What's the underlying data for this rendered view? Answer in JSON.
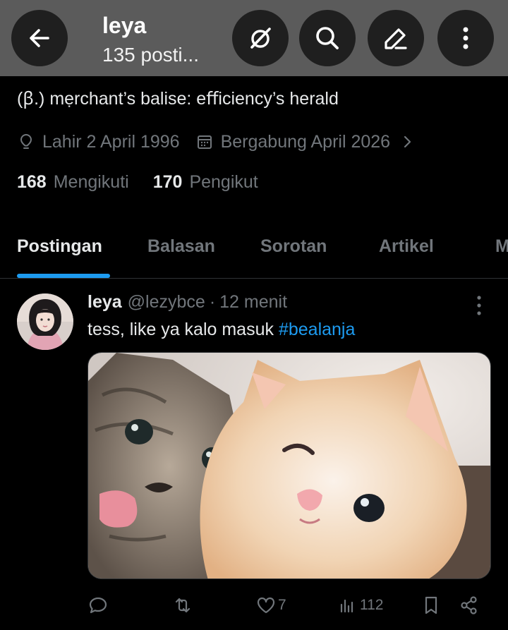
{
  "header": {
    "title": "leya",
    "subtitle": "135 posti..."
  },
  "profile": {
    "bio": "(ꞵ.) mẹrchant’s balise: eﬀiciency’s herald",
    "birth": "Lahir 2 April 1996",
    "joined": "Bergabung April 2026",
    "following_count": "168",
    "following_label": "Mengikuti",
    "followers_count": "170",
    "followers_label": "Pengikut"
  },
  "tabs": [
    "Postingan",
    "Balasan",
    "Sorotan",
    "Artikel",
    "M"
  ],
  "post": {
    "name": "leya",
    "handle": "@lezybce",
    "dot": "·",
    "time": "12 menit",
    "text": "tess, like ya kalo masuk",
    "hashtag": "#bealanja",
    "likes": "7",
    "views": "112"
  },
  "icons": {
    "back": "arrow-left-icon",
    "grok": "grok-icon",
    "search": "search-icon",
    "edit": "pencil-icon",
    "more": "more-vertical-icon",
    "location": "location-icon",
    "calendar": "calendar-icon",
    "reply": "reply-icon",
    "retweet": "retweet-icon",
    "like": "heart-icon",
    "views": "views-icon",
    "bookmark": "bookmark-icon",
    "share": "share-icon"
  },
  "colors": {
    "accent": "#1d9bf0",
    "background": "#000000",
    "header": "#5b5b5b",
    "secondary_text": "#71767b"
  }
}
